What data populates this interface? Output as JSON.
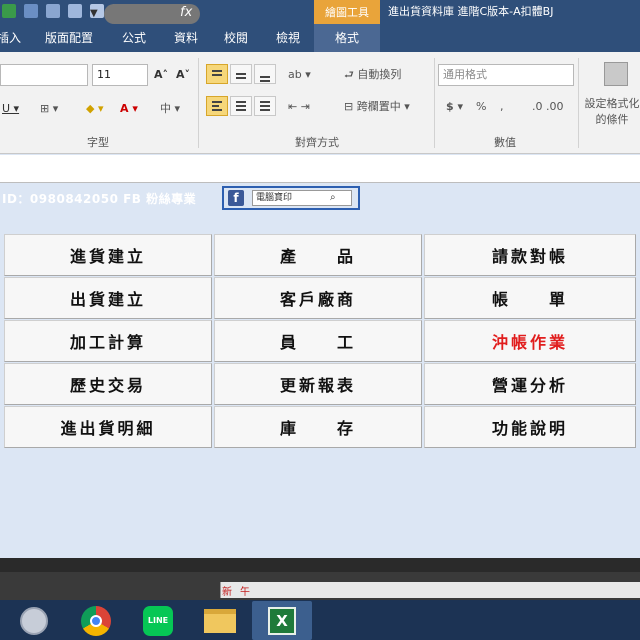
{
  "window": {
    "contextual_tab": "繪圖工具",
    "title": "進出貨資料庫 進階C版本-A扣體BJ"
  },
  "ribbon_tabs": [
    "插入",
    "版面配置",
    "公式",
    "資料",
    "校閱",
    "檢視",
    "格式"
  ],
  "ribbon": {
    "font_size": "11",
    "wrap_text": "自動換列",
    "merge_center": "跨欄置中",
    "number_format": "通用格式",
    "conditional_format": "設定格式化的條件",
    "groups": {
      "font": "字型",
      "alignment": "對齊方式",
      "number": "數值"
    }
  },
  "formula_bar": {
    "fx": "fx"
  },
  "sheet": {
    "info_text": "ID：0980842050 FB 粉絲專業",
    "fb_search_text": "電腦寶印",
    "buttons": [
      {
        "label": "進貨建立",
        "color": "#111111"
      },
      {
        "label": "產　　品",
        "color": "#111111"
      },
      {
        "label": "請款對帳",
        "color": "#111111"
      },
      {
        "label": "出貨建立",
        "color": "#111111"
      },
      {
        "label": "客戶廠商",
        "color": "#111111"
      },
      {
        "label": "帳　　單",
        "color": "#111111"
      },
      {
        "label": "加工計算",
        "color": "#111111"
      },
      {
        "label": "員　　工",
        "color": "#111111"
      },
      {
        "label": "沖帳作業",
        "color": "#e11d1d"
      },
      {
        "label": "歷史交易",
        "color": "#111111"
      },
      {
        "label": "更新報表",
        "color": "#111111"
      },
      {
        "label": "營運分析",
        "color": "#111111"
      },
      {
        "label": "進出貨明細",
        "color": "#111111"
      },
      {
        "label": "庫　　存",
        "color": "#111111"
      },
      {
        "label": "功能說明",
        "color": "#111111"
      }
    ]
  },
  "sheet_tabs": [
    "新",
    "午"
  ],
  "taskbar": {
    "apps": [
      "photo-viewer-icon",
      "chrome-icon",
      "line-icon",
      "file-explorer-icon",
      "excel-icon"
    ],
    "line_label": "LINE"
  },
  "colors": {
    "title_bar": "#2f4f7a",
    "contextual_tab": "#e9a43a",
    "sheet_background": "#dce6f4",
    "taskbar": "#1c3354"
  }
}
